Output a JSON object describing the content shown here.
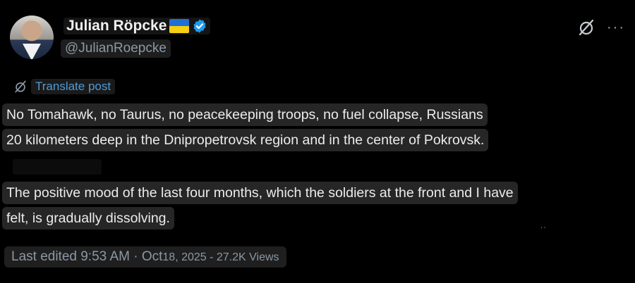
{
  "author": {
    "display_name": "Julian Röpcke",
    "handle": "@JulianRoepcke",
    "flag_icon": "ukraine-flag-icon",
    "verified_icon": "verified-badge-icon",
    "verified_color": "#1d9bf0"
  },
  "actions": {
    "grok_icon": "grok-icon",
    "more_label": "···"
  },
  "translate": {
    "label": "Translate post",
    "icon": "grok-icon"
  },
  "post": {
    "line1": "No Tomahawk, no Taurus, no peacekeeping troops, no fuel collapse, Russians",
    "line2": "20 kilometers deep in the Dnipropetrovsk region and in the center of Pokrovsk.",
    "line3": "The positive mood of the last four months, which the soldiers at the front and I have",
    "line4": "felt, is gradually dissolving."
  },
  "meta": {
    "edited": "Last edited 9:53 AM · Oct",
    "rest": "18, 2025 - 27.2K Views"
  },
  "colors": {
    "background": "#000000",
    "text": "#ececec",
    "muted": "#8b98a5",
    "link": "#4e9bd6"
  }
}
